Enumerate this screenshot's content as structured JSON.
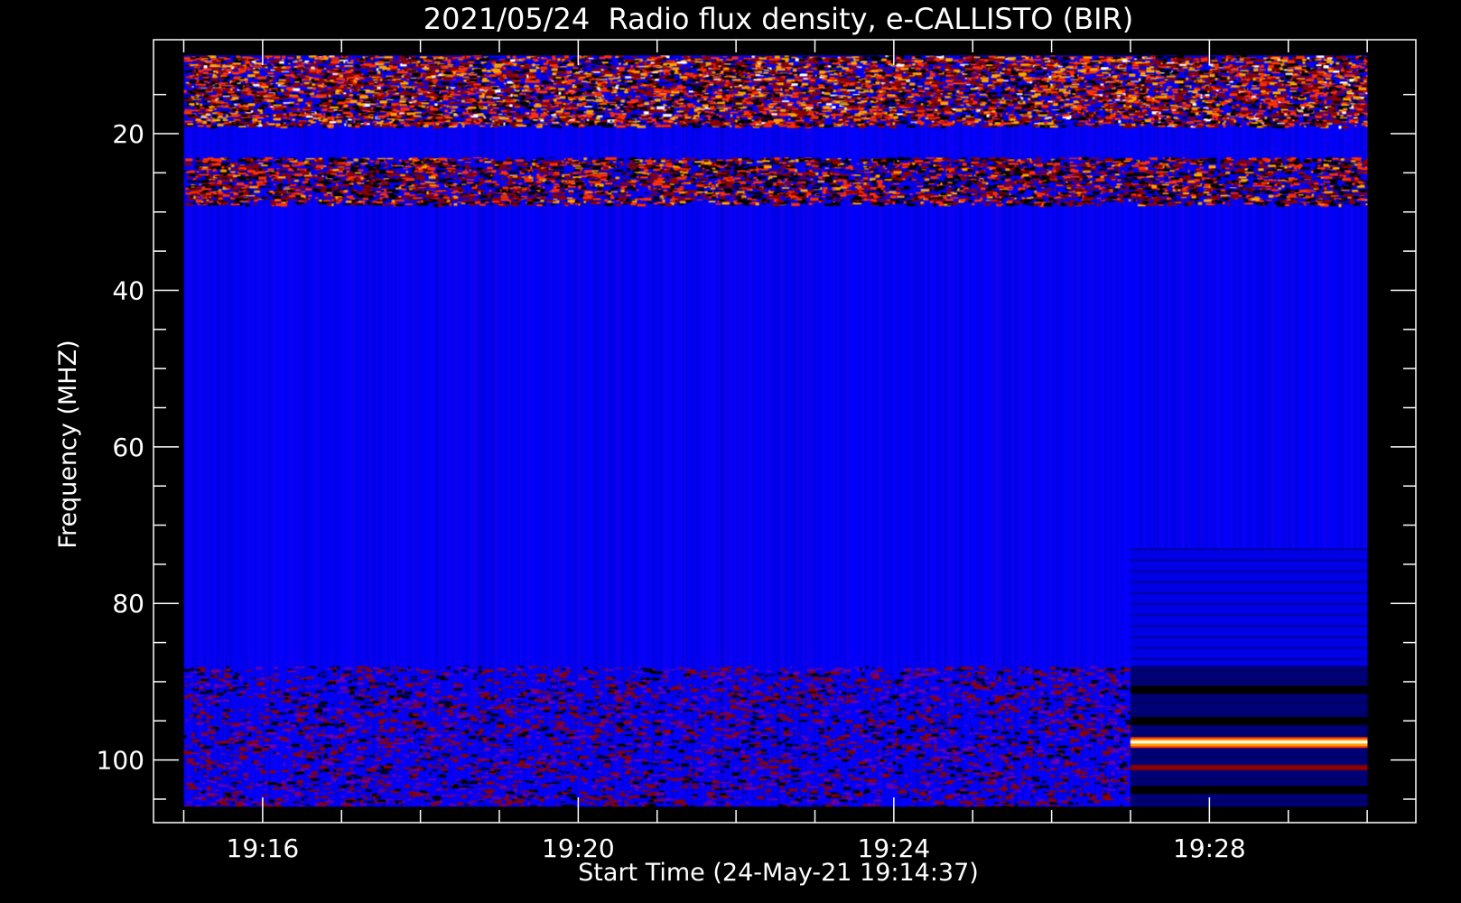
{
  "chart_data": {
    "type": "heatmap",
    "title": "2021/05/24  Radio flux density, e-CALLISTO (BIR)",
    "xlabel": "Start Time (24-May-21 19:14:37)",
    "ylabel": "Frequency (MHZ)",
    "x_ticks": [
      "19:16",
      "19:20",
      "19:24",
      "19:28"
    ],
    "x_tick_minutes": [
      16,
      20,
      24,
      28
    ],
    "x_range": [
      "19:14:37",
      "19:30:37"
    ],
    "data_x_range": [
      "19:15:00",
      "19:30:00"
    ],
    "y_ticks": [
      20,
      40,
      60,
      80,
      100
    ],
    "y_range": [
      8,
      108
    ],
    "data_y_range": [
      10,
      106
    ],
    "y_inverted": true,
    "bands": [
      {
        "f_from": 10,
        "f_to": 19,
        "level": "high"
      },
      {
        "f_from": 19,
        "f_to": 23,
        "level": "background"
      },
      {
        "f_from": 23,
        "f_to": 29,
        "level": "medium"
      },
      {
        "f_from": 29,
        "f_to": 88,
        "level": "background"
      },
      {
        "f_from": 88,
        "f_to": 106,
        "level": "low"
      }
    ],
    "late_segment": {
      "start": "19:27:00",
      "end": "19:30:00",
      "lines": [
        {
          "freq": 91,
          "level": "dark"
        },
        {
          "freq": 95,
          "level": "dark"
        },
        {
          "freq": 97.8,
          "level": "bright"
        },
        {
          "freq": 101,
          "level": "low"
        },
        {
          "freq": 103.8,
          "level": "dark"
        }
      ]
    },
    "colors": {
      "background": "#0000ff",
      "dark": "#000000",
      "low": "#8b0000",
      "medium": "#ff3000",
      "high": "#ffa500",
      "peak": "#ffffff"
    }
  }
}
